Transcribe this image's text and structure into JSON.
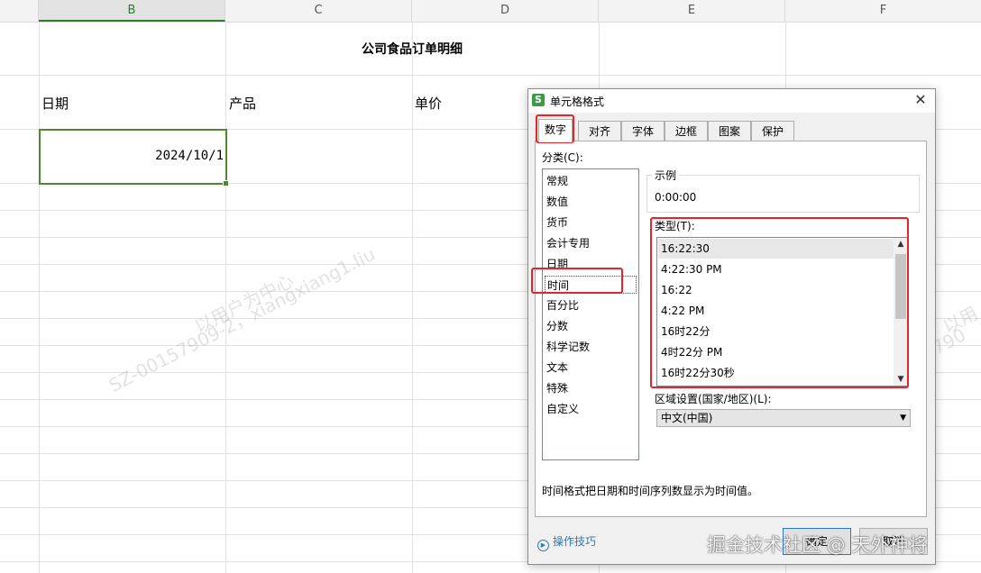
{
  "sheet": {
    "columns": [
      "B",
      "C",
      "D",
      "E",
      "F"
    ],
    "selected_column": "B",
    "title": "公司食品订单明细",
    "headers": {
      "date": "日期",
      "product": "产品",
      "price": "单价"
    },
    "cell_value": "2024/10/1",
    "watermark": {
      "line1": "以用户为中心",
      "line2": "SZ-00157909-2，xiangxiang1.liu",
      "right1": "以用",
      "right2": "SZ-0015790"
    }
  },
  "dialog": {
    "title": "单元格格式",
    "app_icon": "S",
    "close_glyph": "✕",
    "tabs": [
      "数字",
      "对齐",
      "字体",
      "边框",
      "图案",
      "保护"
    ],
    "active_tab": "数字",
    "category_label": "分类(C):",
    "categories": [
      "常规",
      "数值",
      "货币",
      "会计专用",
      "日期",
      "时间",
      "百分比",
      "分数",
      "科学记数",
      "文本",
      "特殊",
      "自定义"
    ],
    "selected_category": "时间",
    "sample_label": "示例",
    "sample_value": "0:00:00",
    "type_label": "类型(T):",
    "types": [
      "16:22:30",
      "4:22:30 PM",
      "16:22",
      "4:22 PM",
      "16时22分",
      "4时22分 PM",
      "16时22分30秒"
    ],
    "selected_type": "16:22:30",
    "locale_label": "区域设置(国家/地区)(L):",
    "locale_value": "中文(中国)",
    "description": "时间格式把日期和时间序列数显示为时间值。",
    "tips_label": "操作技巧",
    "ok_label": "确定",
    "cancel_label": "取消"
  },
  "corner_watermark": "掘金技术社区 @ 天外神将",
  "colors": {
    "accent_green": "#4a8a2a",
    "highlight_red": "#e8232a",
    "link_blue": "#2a7ab8"
  },
  "icons": [
    "app-s-icon",
    "close-icon",
    "help-circle-icon",
    "scroll-up-icon",
    "scroll-down-icon",
    "dropdown-arrow-icon"
  ]
}
